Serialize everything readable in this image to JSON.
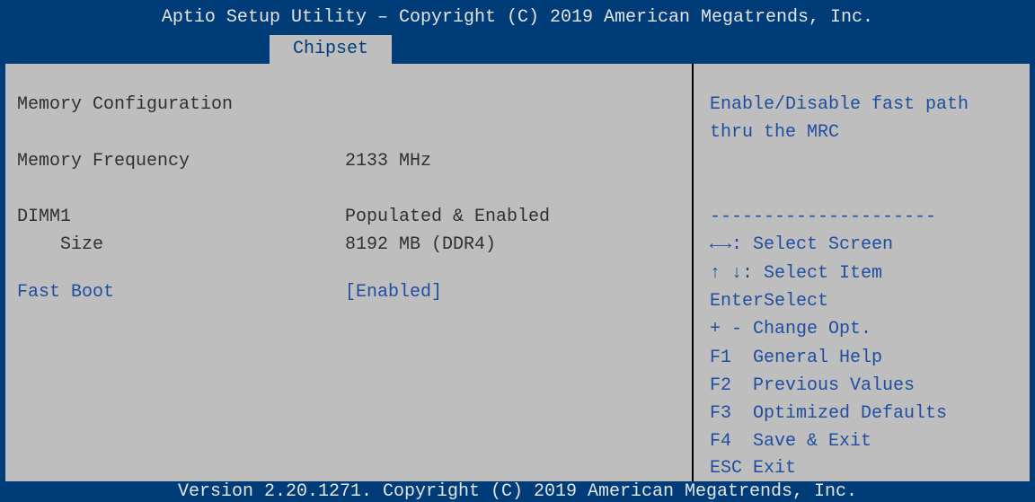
{
  "header": {
    "title": "Aptio Setup Utility – Copyright (C) 2019 American Megatrends, Inc.",
    "active_tab": "Chipset"
  },
  "main": {
    "section_title": "Memory Configuration",
    "rows": [
      {
        "label": "Memory Frequency",
        "value": "2133 MHz"
      },
      {
        "label": "DIMM1",
        "value": "Populated & Enabled"
      },
      {
        "label": "Size",
        "value": "8192 MB (DDR4)"
      }
    ],
    "setting": {
      "label": "Fast Boot",
      "value": "[Enabled]"
    }
  },
  "help_panel": {
    "description_line1": "Enable/Disable fast path",
    "description_line2": "thru the MRC",
    "separator": "---------------------",
    "keys": [
      {
        "key": "←→",
        "action": ": Select Screen"
      },
      {
        "key": "↑ ↓",
        "action": ": Select Item"
      },
      {
        "key": "Enter",
        "action": "Select"
      },
      {
        "key": "+ -",
        "action": "Change Opt."
      },
      {
        "key": "F1",
        "action": "General Help"
      },
      {
        "key": "F2",
        "action": "Previous Values"
      },
      {
        "key": "F3",
        "action": "Optimized Defaults"
      },
      {
        "key": "F4",
        "action": "Save & Exit"
      },
      {
        "key": "ESC",
        "action": "Exit"
      }
    ]
  },
  "footer": {
    "version": "Version 2.20.1271. Copyright (C) 2019 American Megatrends, Inc."
  },
  "colors": {
    "frame_blue": "#003c78",
    "panel_gray": "#bebebe",
    "highlight_text": "#1f4ea0",
    "normal_text": "#303030"
  }
}
